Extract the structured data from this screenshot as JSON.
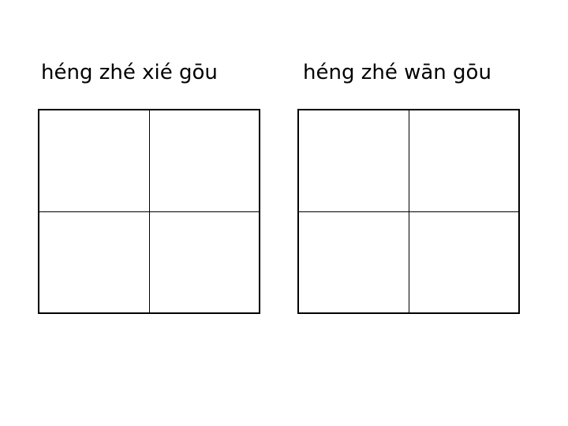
{
  "worksheet": {
    "items": [
      {
        "pinyin": "héng zhé xié gōu"
      },
      {
        "pinyin": "héng zhé wān gōu"
      }
    ]
  }
}
